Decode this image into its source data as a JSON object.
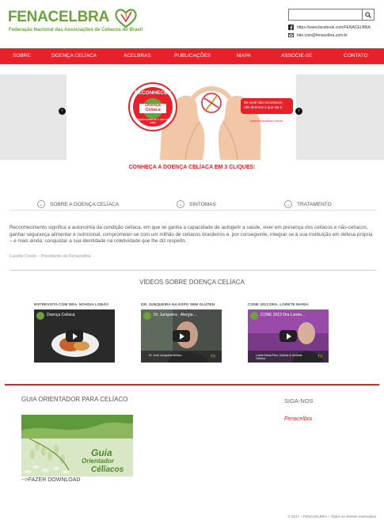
{
  "header": {
    "logo_title": "FENACELBRA",
    "logo_subtitle": "Federação Nacional das Associações de Celíacos do Brasil",
    "search_placeholder": "",
    "facebook_text": "https://www.facebook.com/FENACELBRA",
    "email_text": "fale.com@fenacelbra.com.br"
  },
  "nav": {
    "items": [
      "SOBRE",
      "DOENÇA CELÍACA",
      "ACELBRAS",
      "PUBLICAÇÕES",
      "MAPA",
      "ASSOCIE-SE",
      "CONTATO"
    ]
  },
  "banner": {
    "badge_top": "RECONHECER",
    "badge_mid1": "Doença",
    "badge_mid2": "Celíaca",
    "badge_bottom": "ninguém pode ter o que não sabe",
    "callout": "Se você não reconhecer, não diremos o que ela é.",
    "site": "www.fenacelbra.com.br",
    "prev_icon": "‹",
    "next_icon": "›"
  },
  "conheca": "CONHEÇA A DOENÇA CELÍACA EM 3 CLIQUES:",
  "tabs": [
    "SOBRE A DOENÇA CELÍACA",
    "SINTOMAS",
    "TRATAMENTO"
  ],
  "quote": {
    "text": "Reconhecimento significa a autonomia da condição celíaca, em que se ganha a capacidade de autogerir a saúde, viver em presença dos celíacos e não-celíacos, ganhar segurança alimentar e nutricional, comprometer-se com um milhão de celíacos brasileiros e, por conseguinte, integrar-se à sua instituição em defesa própria – e mais ainda, conquistar a sua identidade na coletividade que lhe diz respeito.",
    "author": "Lucélia Costa – Presidente da Fenacelbra"
  },
  "videos": {
    "title": "VÍDEOS SOBRE DOENÇA CELÍACA",
    "items": [
      {
        "label": "ENTREVISTA COM DRA. NOADIA LOBÃO",
        "title": "Doença Celíaca",
        "caption": ""
      },
      {
        "label": "DR. JUNQUEIRA NA EXPO SEM GLÚTEN",
        "title": "Dr. Junqueira - Alergia ...",
        "caption": "Dr. José Junqueira Médico"
      },
      {
        "label": "CONE 2013 DRA. LORETE MARIA",
        "title": "CONE 2013 Dra Lorete...",
        "caption": "Lorete Maria Pres. Kodvax & Unidade Celíaca"
      }
    ],
    "tv_label": "TV"
  },
  "guia": {
    "title": "GUIA ORIENTADOR PARA CELÍACO",
    "img_line1": "Guia",
    "img_line2": "Orientador",
    "img_line3": "para",
    "img_line4": "Celíacos",
    "download": "-->FAZER DOWNLOAD"
  },
  "siga": {
    "title": "SIGA-NOS",
    "link": "Fenacelbra"
  },
  "footer": "© 2017 – FENACELBRA – Todos os direitos reservados",
  "colors": {
    "brand_green": "#6aa33a",
    "brand_red": "#e8202a"
  }
}
